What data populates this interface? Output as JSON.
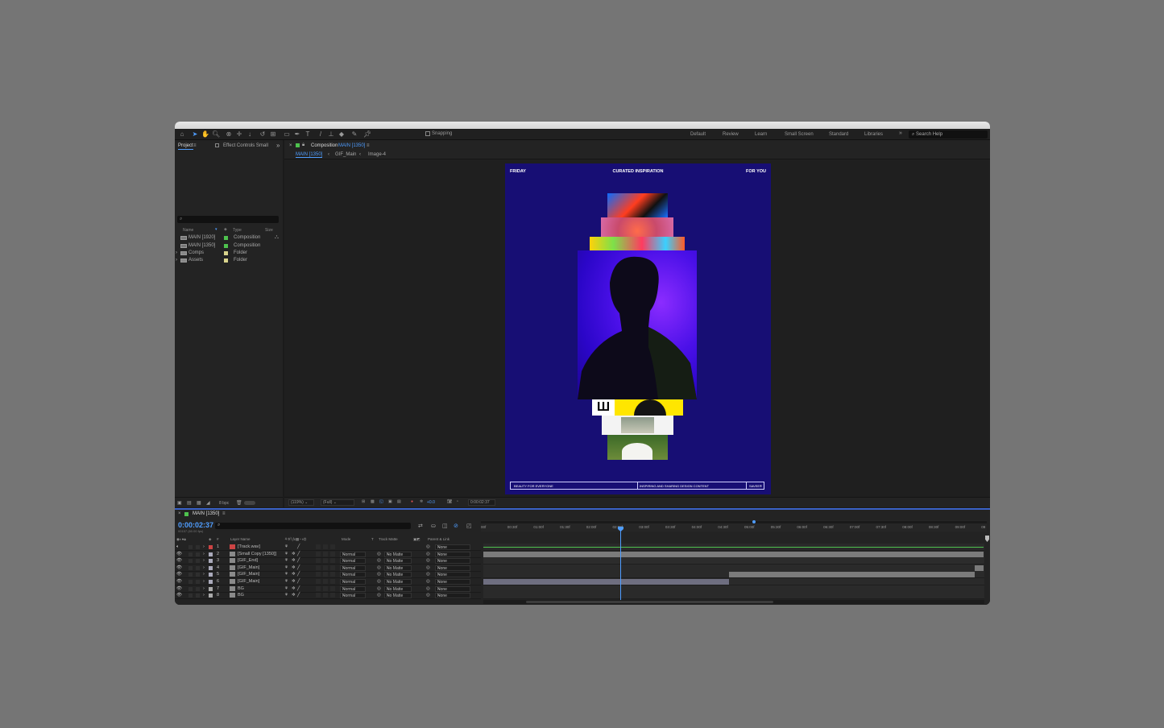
{
  "toolbar": {
    "snapping": "Snapping",
    "workspaces": [
      "Default",
      "Review",
      "Learn",
      "Small Screen",
      "Standard",
      "Libraries"
    ],
    "search_placeholder": "Search Help"
  },
  "project": {
    "tab_project": "Project",
    "tab_effects": "Effect Controls Small",
    "columns": {
      "name": "Name",
      "type": "Type",
      "size": "Size"
    },
    "items": [
      {
        "name": "MAIN [1920]",
        "type": "Composition",
        "color": "#4ec24e"
      },
      {
        "name": "MAIN [1350]",
        "type": "Composition",
        "color": "#4ec24e"
      },
      {
        "name": "Comps",
        "type": "Folder",
        "color": "#d9d48c"
      },
      {
        "name": "Assets",
        "type": "Folder",
        "color": "#d9d48c"
      }
    ],
    "bpc": "8 bpc"
  },
  "viewer": {
    "panel_label": "Composition",
    "panel_comp": "MAIN [1350]",
    "breadcrumbs": [
      "MAIN [1350]",
      "GIF_Main",
      "Image-4"
    ],
    "canvas": {
      "left": "FRIDAY",
      "center": "CURATED INSPIRATION",
      "right": "FOR YOU",
      "footer_1": "BEAUTY FOR EVERYONE",
      "footer_2": "INSPIRING AND SHARING DESIGN CONTENT",
      "footer_3": "SAVEE®",
      "tile_text": "Ш"
    },
    "bottom": {
      "zoom": "(119%)",
      "res": "(Full)",
      "exposure": "+0.0",
      "time": "0:00:02:37"
    }
  },
  "timeline": {
    "comp_name": "MAIN [1350]",
    "timecode": "0:00:02:37",
    "sub_timecode": "00157 (60.00 fps)",
    "columns": {
      "layer": "Layer Name",
      "mode": "Mode",
      "t": "T",
      "matte": "Track Matte",
      "parent": "Parent & Link"
    },
    "ruler": [
      "00f",
      "00:30f",
      "01:00f",
      "01:30f",
      "02:00f",
      "02:30f",
      "03:00f",
      "03:30f",
      "04:00f",
      "04:30f",
      "05:00f",
      "05:30f",
      "06:00f",
      "06:30f",
      "07:00f",
      "07:30f",
      "08:00f",
      "08:30f",
      "09:00f",
      "09"
    ],
    "layers": [
      {
        "num": "1",
        "name": "[Track.wav]",
        "mode": "",
        "matte": "",
        "parent": "None",
        "color": "#c44"
      },
      {
        "num": "2",
        "name": "[Small Copy [1350]]",
        "mode": "Normal",
        "matte": "No Matte",
        "parent": "None",
        "color": "#aab"
      },
      {
        "num": "3",
        "name": "[GIF_End]",
        "mode": "Normal",
        "matte": "No Matte",
        "parent": "None",
        "color": "#aab"
      },
      {
        "num": "4",
        "name": "[GIF_Main]",
        "mode": "Normal",
        "matte": "No Matte",
        "parent": "None",
        "color": "#aab"
      },
      {
        "num": "5",
        "name": "[GIF_Main]",
        "mode": "Normal",
        "matte": "No Matte",
        "parent": "None",
        "color": "#aab"
      },
      {
        "num": "6",
        "name": "[GIF_Main]",
        "mode": "Normal",
        "matte": "No Matte",
        "parent": "None",
        "color": "#aab"
      },
      {
        "num": "7",
        "name": "BG",
        "mode": "Normal",
        "matte": "No Matte",
        "parent": "None",
        "color": "#aaa"
      },
      {
        "num": "8",
        "name": "BG",
        "mode": "Normal",
        "matte": "No Matte",
        "parent": "None",
        "color": "#aaa"
      }
    ]
  }
}
